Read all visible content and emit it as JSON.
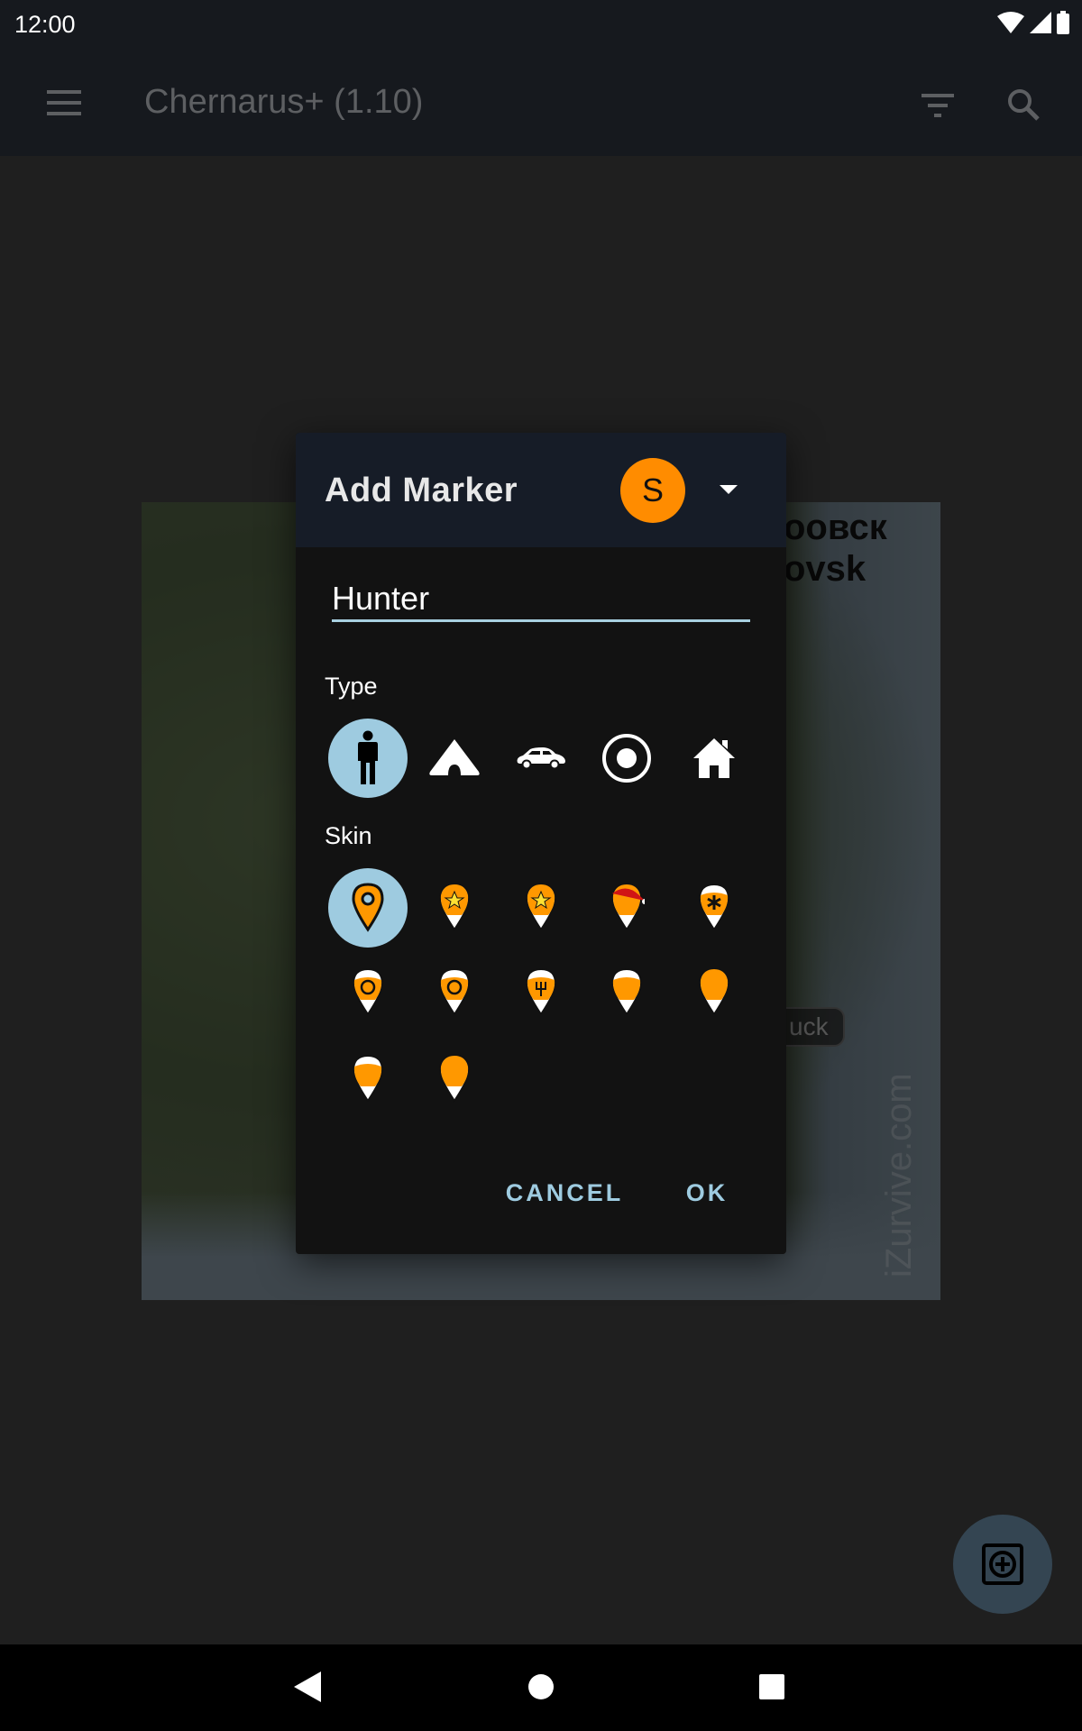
{
  "status_bar": {
    "time": "12:00",
    "icons": [
      "wifi-icon",
      "signal-icon",
      "battery-icon"
    ]
  },
  "toolbar": {
    "title": "Chernarus+ (1.10)",
    "icons": [
      "menu-icon",
      "filter-icon",
      "search-icon"
    ]
  },
  "map": {
    "labels": [
      "оовск",
      "ovsk",
      "uck"
    ],
    "watermark": "iZurvive.com"
  },
  "dialog": {
    "title": "Add Marker",
    "avatar_letter": "S",
    "avatar_color": "#ff8c00",
    "name_value": "Hunter",
    "type_label": "Type",
    "types": [
      {
        "icon": "person-icon",
        "selected": true
      },
      {
        "icon": "tent-icon",
        "selected": false
      },
      {
        "icon": "car-icon",
        "selected": false
      },
      {
        "icon": "target-circle-icon",
        "selected": false
      },
      {
        "icon": "house-icon",
        "selected": false
      }
    ],
    "skin_label": "Skin",
    "skins": [
      {
        "icon": "pin-plain-icon",
        "selected": true
      },
      {
        "icon": "pin-camo-star-icon"
      },
      {
        "icon": "pin-star-ribbon-icon"
      },
      {
        "icon": "pin-santa-hat-icon"
      },
      {
        "icon": "pin-medic-icon"
      },
      {
        "icon": "pin-crosshair-icon"
      },
      {
        "icon": "pin-steering-wheel-icon"
      },
      {
        "icon": "pin-fork-icon"
      },
      {
        "icon": "pin-cap-icon"
      },
      {
        "icon": "pin-beret-icon"
      },
      {
        "icon": "pin-helmet-icon"
      },
      {
        "icon": "pin-zombie-icon"
      }
    ],
    "cancel_label": "CANCEL",
    "ok_label": "OK",
    "accent": "#9ecbe0"
  },
  "fab": {
    "icon": "add-marker-icon"
  },
  "nav_bar": {
    "icons": [
      "back-icon",
      "home-icon",
      "recents-icon"
    ]
  }
}
